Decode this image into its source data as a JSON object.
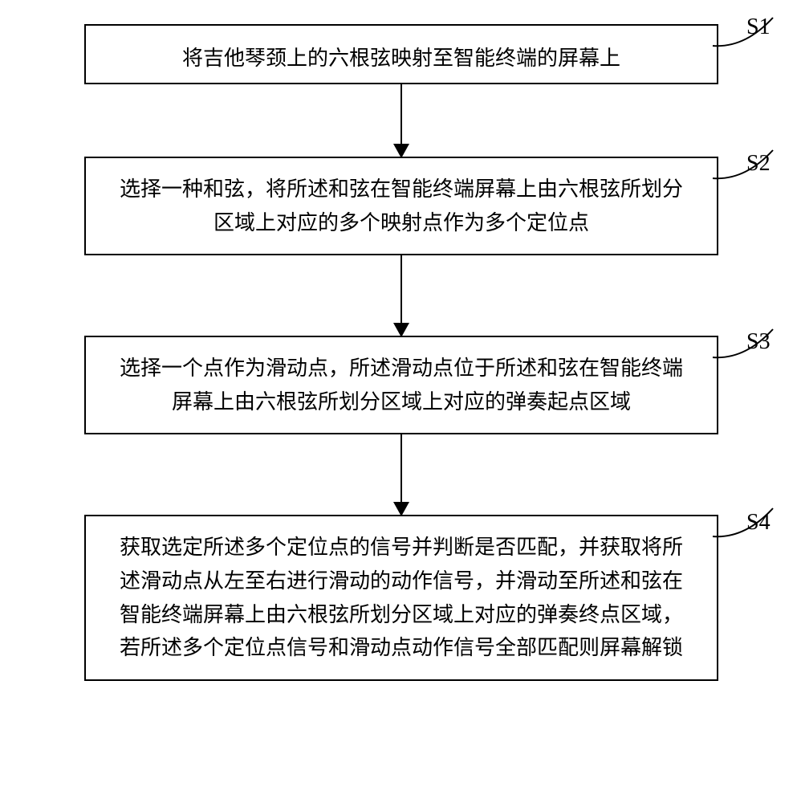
{
  "flowchart": {
    "steps": [
      {
        "id": "S1",
        "text": "将吉他琴颈上的六根弦映射至智能终端的屏幕上"
      },
      {
        "id": "S2",
        "text": "选择一种和弦，将所述和弦在智能终端屏幕上由六根弦所划分区域上对应的多个映射点作为多个定位点"
      },
      {
        "id": "S3",
        "text": "选择一个点作为滑动点，所述滑动点位于所述和弦在智能终端屏幕上由六根弦所划分区域上对应的弹奏起点区域"
      },
      {
        "id": "S4",
        "text": "获取选定所述多个定位点的信号并判断是否匹配，并获取将所述滑动点从左至右进行滑动的动作信号，并滑动至所述和弦在智能终端屏幕上由六根弦所划分区域上对应的弹奏终点区域，若所述多个定位点信号和滑动点动作信号全部匹配则屏幕解锁"
      }
    ]
  }
}
